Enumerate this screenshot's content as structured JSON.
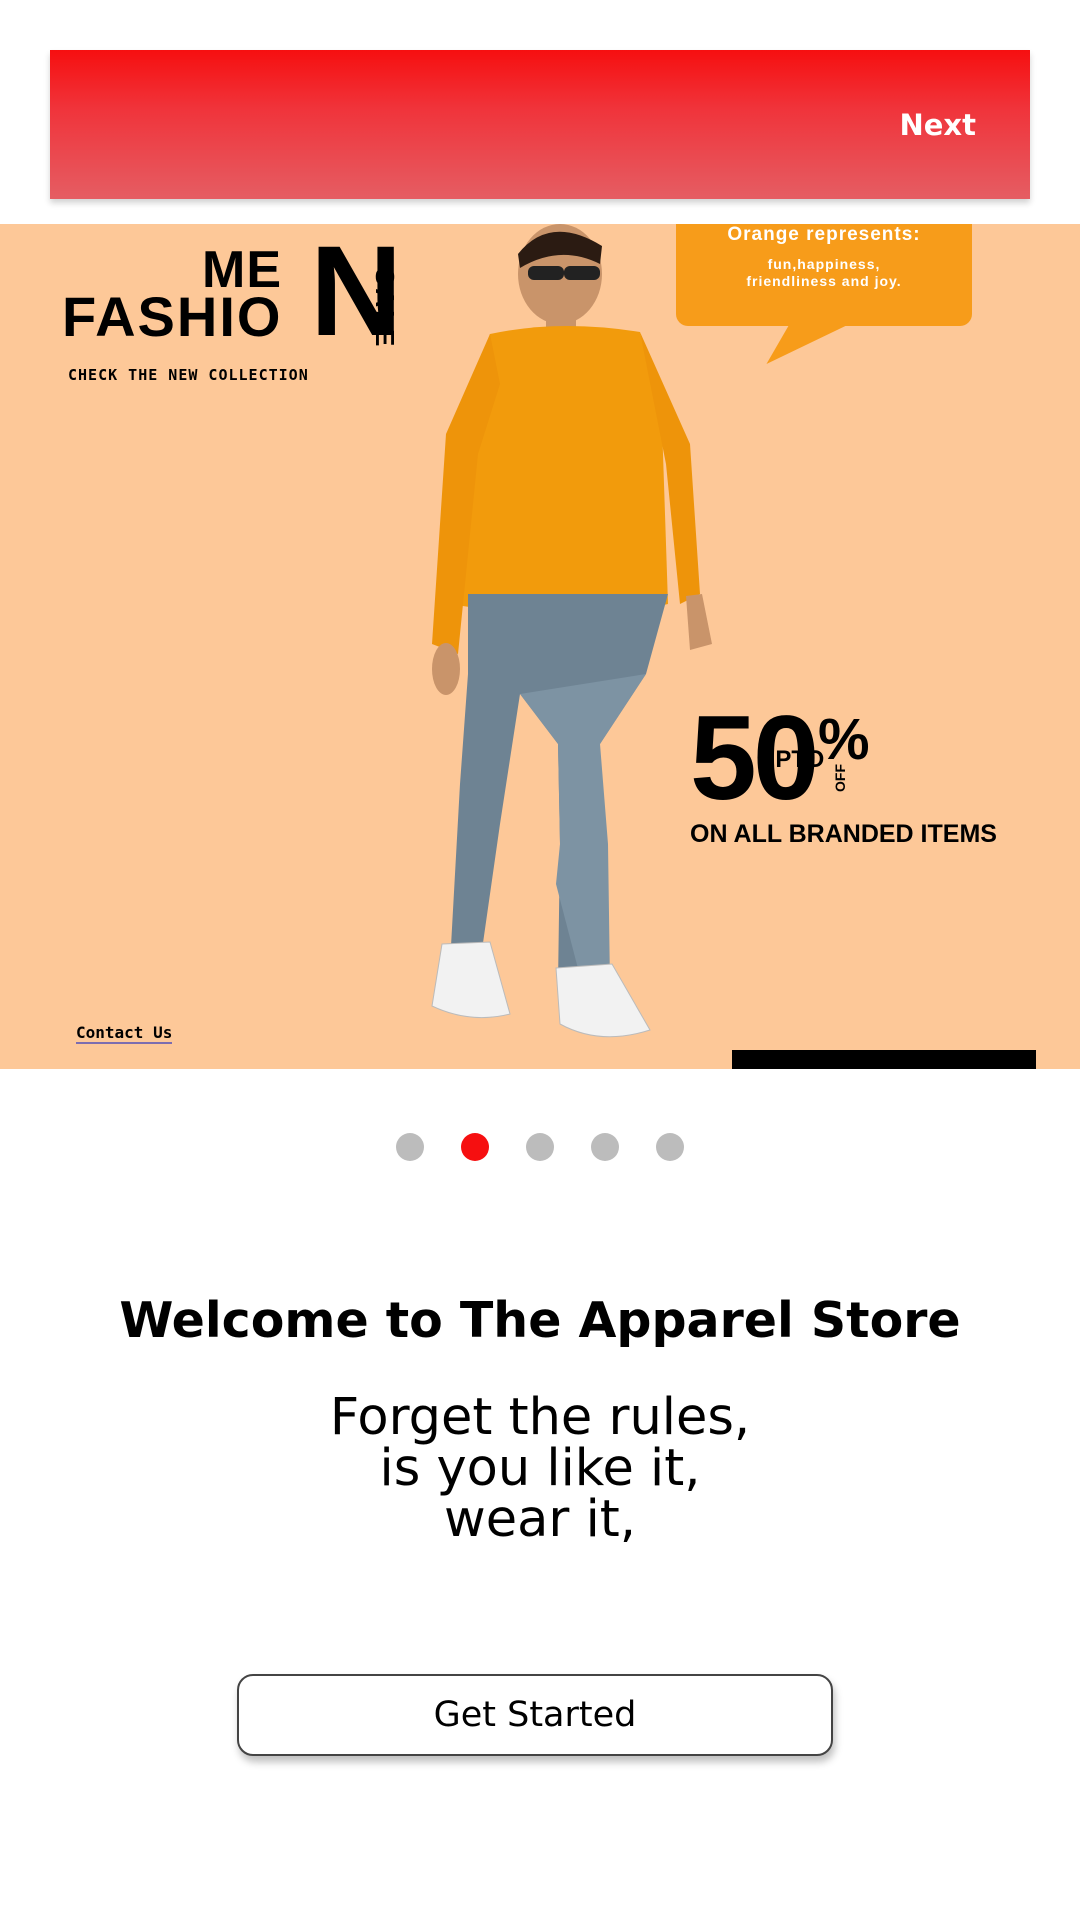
{
  "header": {
    "next_label": "Next"
  },
  "banner": {
    "brand_men": "ME",
    "brand_n": "N",
    "brand_fashion": "FASHIO",
    "brand_sale": "SALE",
    "brand_tagline": "CHECK THE NEW COLLECTION",
    "bubble_title": "Orange represents:",
    "bubble_body_1": "fun,happiness,",
    "bubble_body_2": "friendliness and joy.",
    "offer_number": "50",
    "offer_upto": "UPTO",
    "offer_percent": "%",
    "offer_off": "OFF",
    "offer_line": "ON ALL BRANDED ITEMS",
    "contact_label": "Contact Us"
  },
  "carousel": {
    "dot_count": 5,
    "active_index": 1
  },
  "main": {
    "welcome_title": "Welcome to The Apparel Store",
    "tagline_line1": "Forget the rules,",
    "tagline_line2": "is you like it,",
    "tagline_line3": "wear it,"
  },
  "cta": {
    "get_started_label": "Get Started"
  },
  "colors": {
    "accent": "#f60f10",
    "banner_bg": "#fdc898",
    "bubble": "#f79c1a",
    "dot_inactive": "#bcbcbc"
  }
}
